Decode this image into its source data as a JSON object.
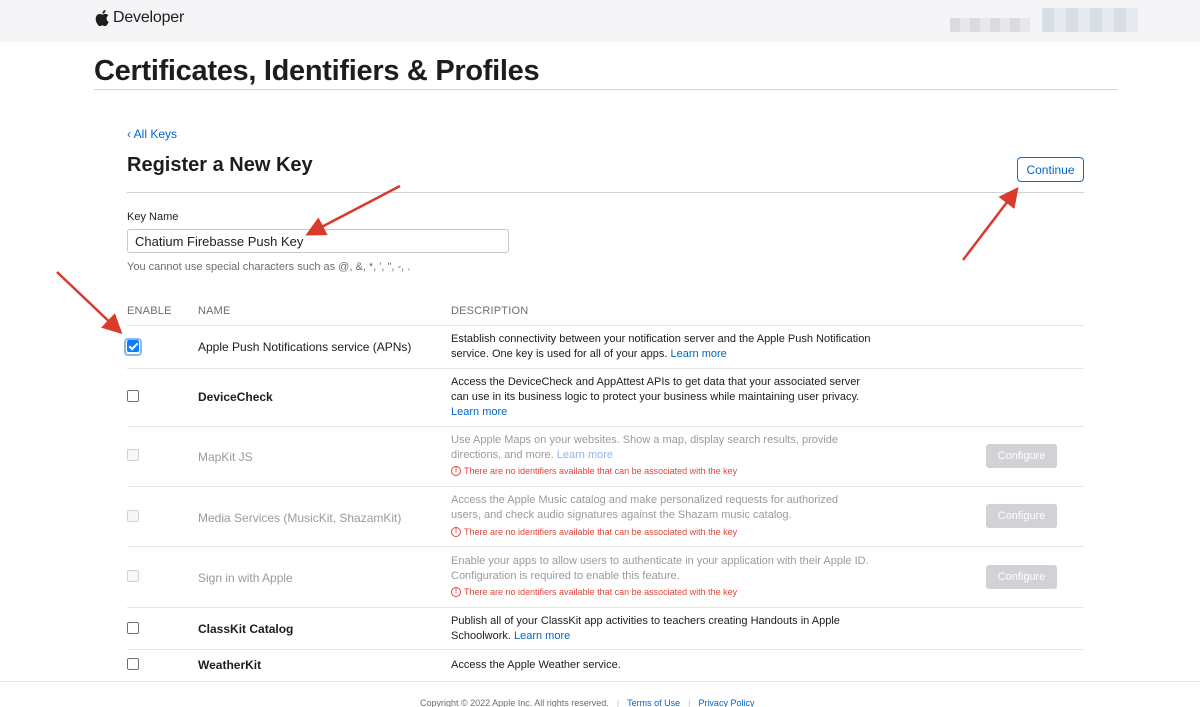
{
  "nav": {
    "brand": "Developer",
    "logo_icon": "apple-logo-icon"
  },
  "page": {
    "title": "Certificates, Identifiers & Profiles"
  },
  "section": {
    "back_link": "‹ All Keys",
    "title": "Register a New Key",
    "continue_label": "Continue"
  },
  "form": {
    "key_name_label": "Key Name",
    "key_name_value": "Chatium Firebasse Push Key",
    "hint": "You cannot use special characters such as @, &, *, ', \", -, ."
  },
  "table": {
    "headers": {
      "enable": "ENABLE",
      "name": "NAME",
      "description": "DESCRIPTION"
    },
    "rows": [
      {
        "name": "Apple Push Notifications service (APNs)",
        "desc": "Establish connectivity between your notification server and the Apple Push Notification service. One key is used for all of your apps.",
        "link": "Learn more",
        "checked": true,
        "disabled": false
      },
      {
        "name": "DeviceCheck",
        "desc": "Access the DeviceCheck and AppAttest APIs to get data that your associated server can use in its business logic to protect your business while maintaining user privacy.",
        "link": "Learn more",
        "checked": false,
        "disabled": false
      },
      {
        "name": "MapKit JS",
        "desc": "Use Apple Maps on your websites. Show a map, display search results, provide directions, and more.",
        "link": "Learn more",
        "warning": "There are no identifiers available that can be associated with the key",
        "configure": "Configure",
        "checked": false,
        "disabled": true
      },
      {
        "name": "Media Services (MusicKit, ShazamKit)",
        "desc": "Access the Apple Music catalog and make personalized requests for authorized users, and check audio signatures against the Shazam music catalog.",
        "warning": "There are no identifiers available that can be associated with the key",
        "configure": "Configure",
        "checked": false,
        "disabled": true
      },
      {
        "name": "Sign in with Apple",
        "desc": "Enable your apps to allow users to authenticate in your application with their Apple ID. Configuration is required to enable this feature.",
        "warning": "There are no identifiers available that can be associated with the key",
        "configure": "Configure",
        "checked": false,
        "disabled": true
      },
      {
        "name": "ClassKit Catalog",
        "desc": "Publish all of your ClassKit app activities to teachers creating Handouts in Apple Schoolwork.",
        "link": "Learn more",
        "checked": false,
        "disabled": false
      },
      {
        "name": "WeatherKit",
        "desc": "Access the Apple Weather service.",
        "checked": false,
        "disabled": false
      }
    ]
  },
  "footer": {
    "copyright": "Copyright © 2022 Apple Inc. All rights reserved.",
    "terms": "Terms of Use",
    "privacy": "Privacy Policy"
  },
  "colors": {
    "accent": "#0066cc",
    "annotation_arrow": "#d93a2b",
    "warning": "#e0463c"
  }
}
